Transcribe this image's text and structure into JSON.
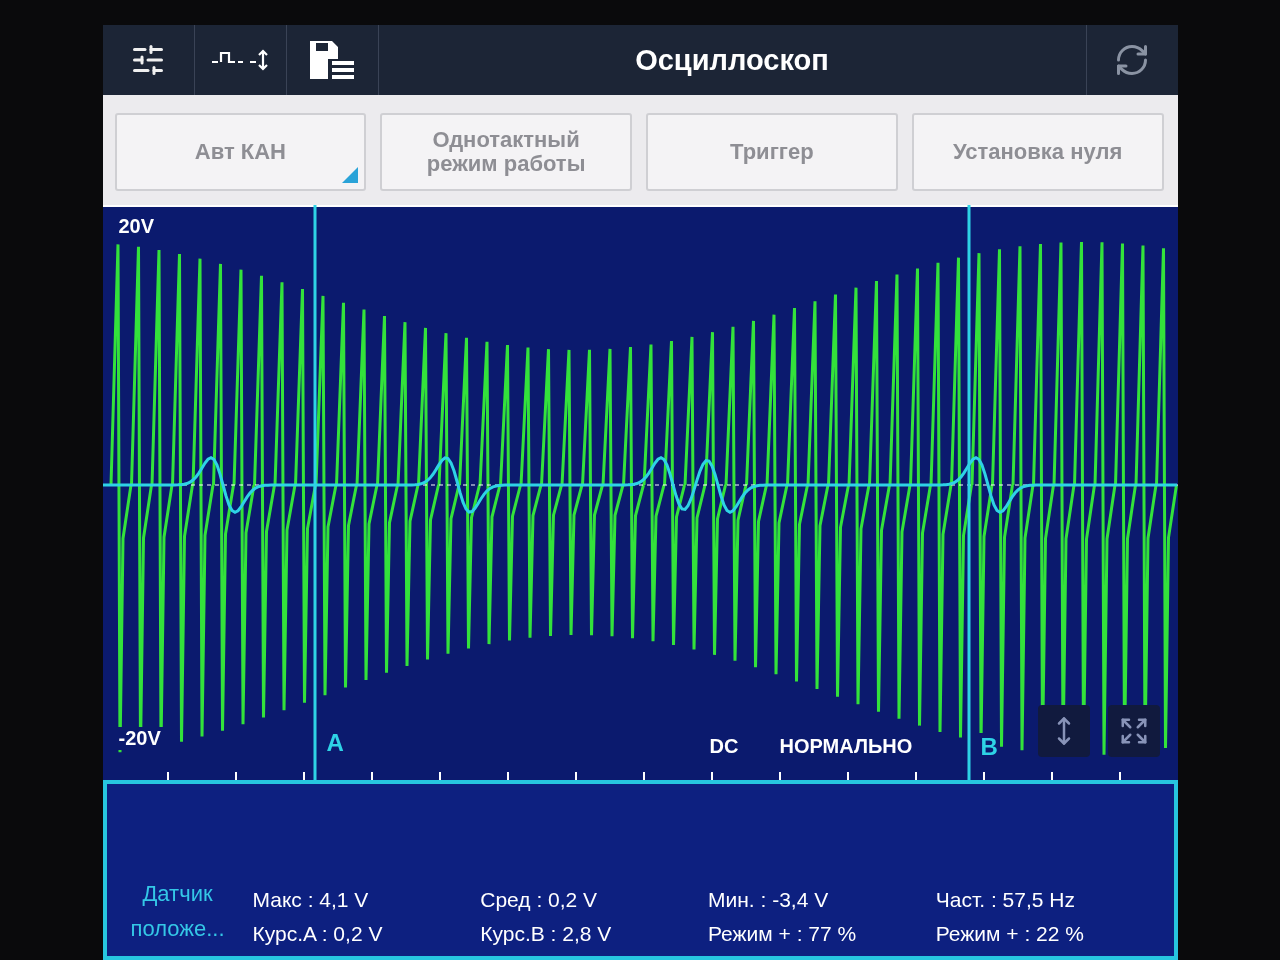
{
  "toolbar": {
    "title": "Осциллоскоп"
  },
  "mode_buttons": [
    {
      "label": "Авт КАН",
      "disabled": true,
      "kind": "dropdown"
    },
    {
      "label": "Однотактный режим работы",
      "disabled": true,
      "kind": "plain"
    },
    {
      "label": "Триггер",
      "disabled": true,
      "kind": "plain"
    },
    {
      "label": "Установка нуля",
      "disabled": true,
      "kind": "plain"
    }
  ],
  "scope": {
    "y_max": "20V",
    "y_min": "-20V",
    "cursor_a": "A",
    "cursor_b": "B",
    "coupling": "DC",
    "mode": "НОРМАЛЬНО"
  },
  "readout": {
    "sensor": "Датчик положе...",
    "values": [
      "Макс : 4,1 V",
      "Курс.A : 0,2 V",
      "Сред : 0,2 V",
      "Курс.B : 2,8 V",
      "Мин. : -3,4 V",
      "Режим + : 77 %",
      "Част. : 57,5 Hz",
      "Режим + : 22 %"
    ]
  }
}
